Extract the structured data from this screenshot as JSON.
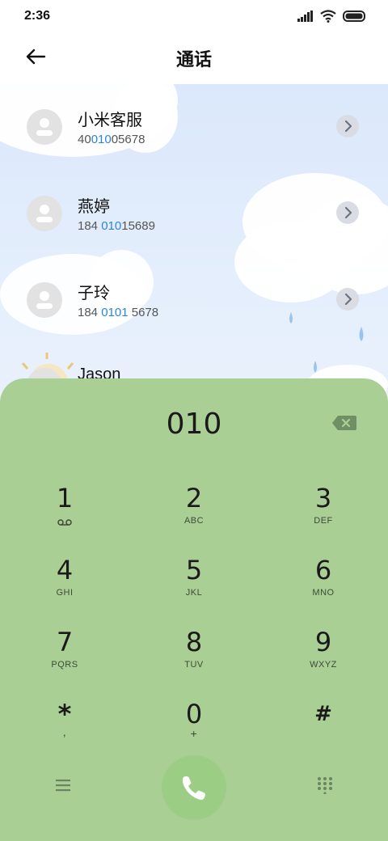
{
  "status_bar": {
    "time": "2:36"
  },
  "header": {
    "title": "通话"
  },
  "contacts": [
    {
      "name": "小米客服",
      "number_pre": "40",
      "number_hl": "010",
      "number_post": "05678"
    },
    {
      "name": "燕婷",
      "number_pre": "184 ",
      "number_hl": "010",
      "number_post": "15689"
    },
    {
      "name": "子玲",
      "number_pre": "184 ",
      "number_hl": "0101",
      "number_post": " 5678"
    },
    {
      "name": "Jason"
    }
  ],
  "dialpad": {
    "input": "010",
    "keys": [
      {
        "digit": "1",
        "letters": ""
      },
      {
        "digit": "2",
        "letters": "ABC"
      },
      {
        "digit": "3",
        "letters": "DEF"
      },
      {
        "digit": "4",
        "letters": "GHI"
      },
      {
        "digit": "5",
        "letters": "JKL"
      },
      {
        "digit": "6",
        "letters": "MNO"
      },
      {
        "digit": "7",
        "letters": "PQRS"
      },
      {
        "digit": "8",
        "letters": "TUV"
      },
      {
        "digit": "9",
        "letters": "WXYZ"
      },
      {
        "digit": "*",
        "letters": ","
      },
      {
        "digit": "0",
        "letters": "+"
      },
      {
        "digit": "#",
        "letters": ""
      }
    ]
  },
  "colors": {
    "panel": "#aacf95",
    "call_button": "#9bce84",
    "highlight": "#2a86d9",
    "sky": "#dbe8fb"
  },
  "icons": [
    "signal-icon",
    "wifi-icon",
    "battery-icon",
    "back-arrow-icon",
    "person-icon",
    "chevron-right-icon",
    "backspace-icon",
    "voicemail-icon",
    "menu-icon",
    "phone-icon",
    "dialpad-grid-icon"
  ]
}
